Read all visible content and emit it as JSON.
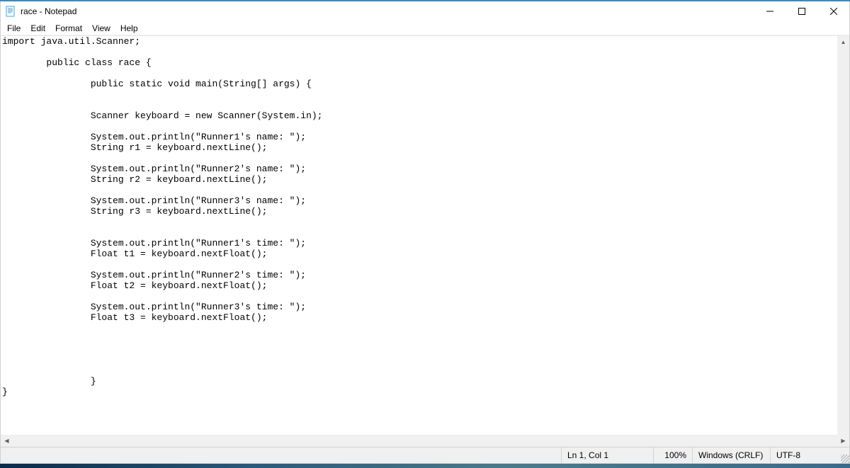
{
  "window": {
    "title": "race - Notepad"
  },
  "menubar": {
    "file": "File",
    "edit": "Edit",
    "format": "Format",
    "view": "View",
    "help": "Help"
  },
  "editor": {
    "content": "import java.util.Scanner;\n\n        public class race {\n\n                public static void main(String[] args) {\n\n\n                Scanner keyboard = new Scanner(System.in);\n\n                System.out.println(\"Runner1's name: \");\n                String r1 = keyboard.nextLine();\n\n                System.out.println(\"Runner2's name: \");\n                String r2 = keyboard.nextLine();\n\n                System.out.println(\"Runner3's name: \");\n                String r3 = keyboard.nextLine();\n\n\n                System.out.println(\"Runner1's time: \");\n                Float t1 = keyboard.nextFloat();\n\n                System.out.println(\"Runner2's time: \");\n                Float t2 = keyboard.nextFloat();\n\n                System.out.println(\"Runner3's time: \");\n                Float t3 = keyboard.nextFloat();\n\n\n\n\n\n                }\n}"
  },
  "statusbar": {
    "position": "Ln 1, Col 1",
    "zoom": "100%",
    "eol": "Windows (CRLF)",
    "encoding": "UTF-8"
  }
}
